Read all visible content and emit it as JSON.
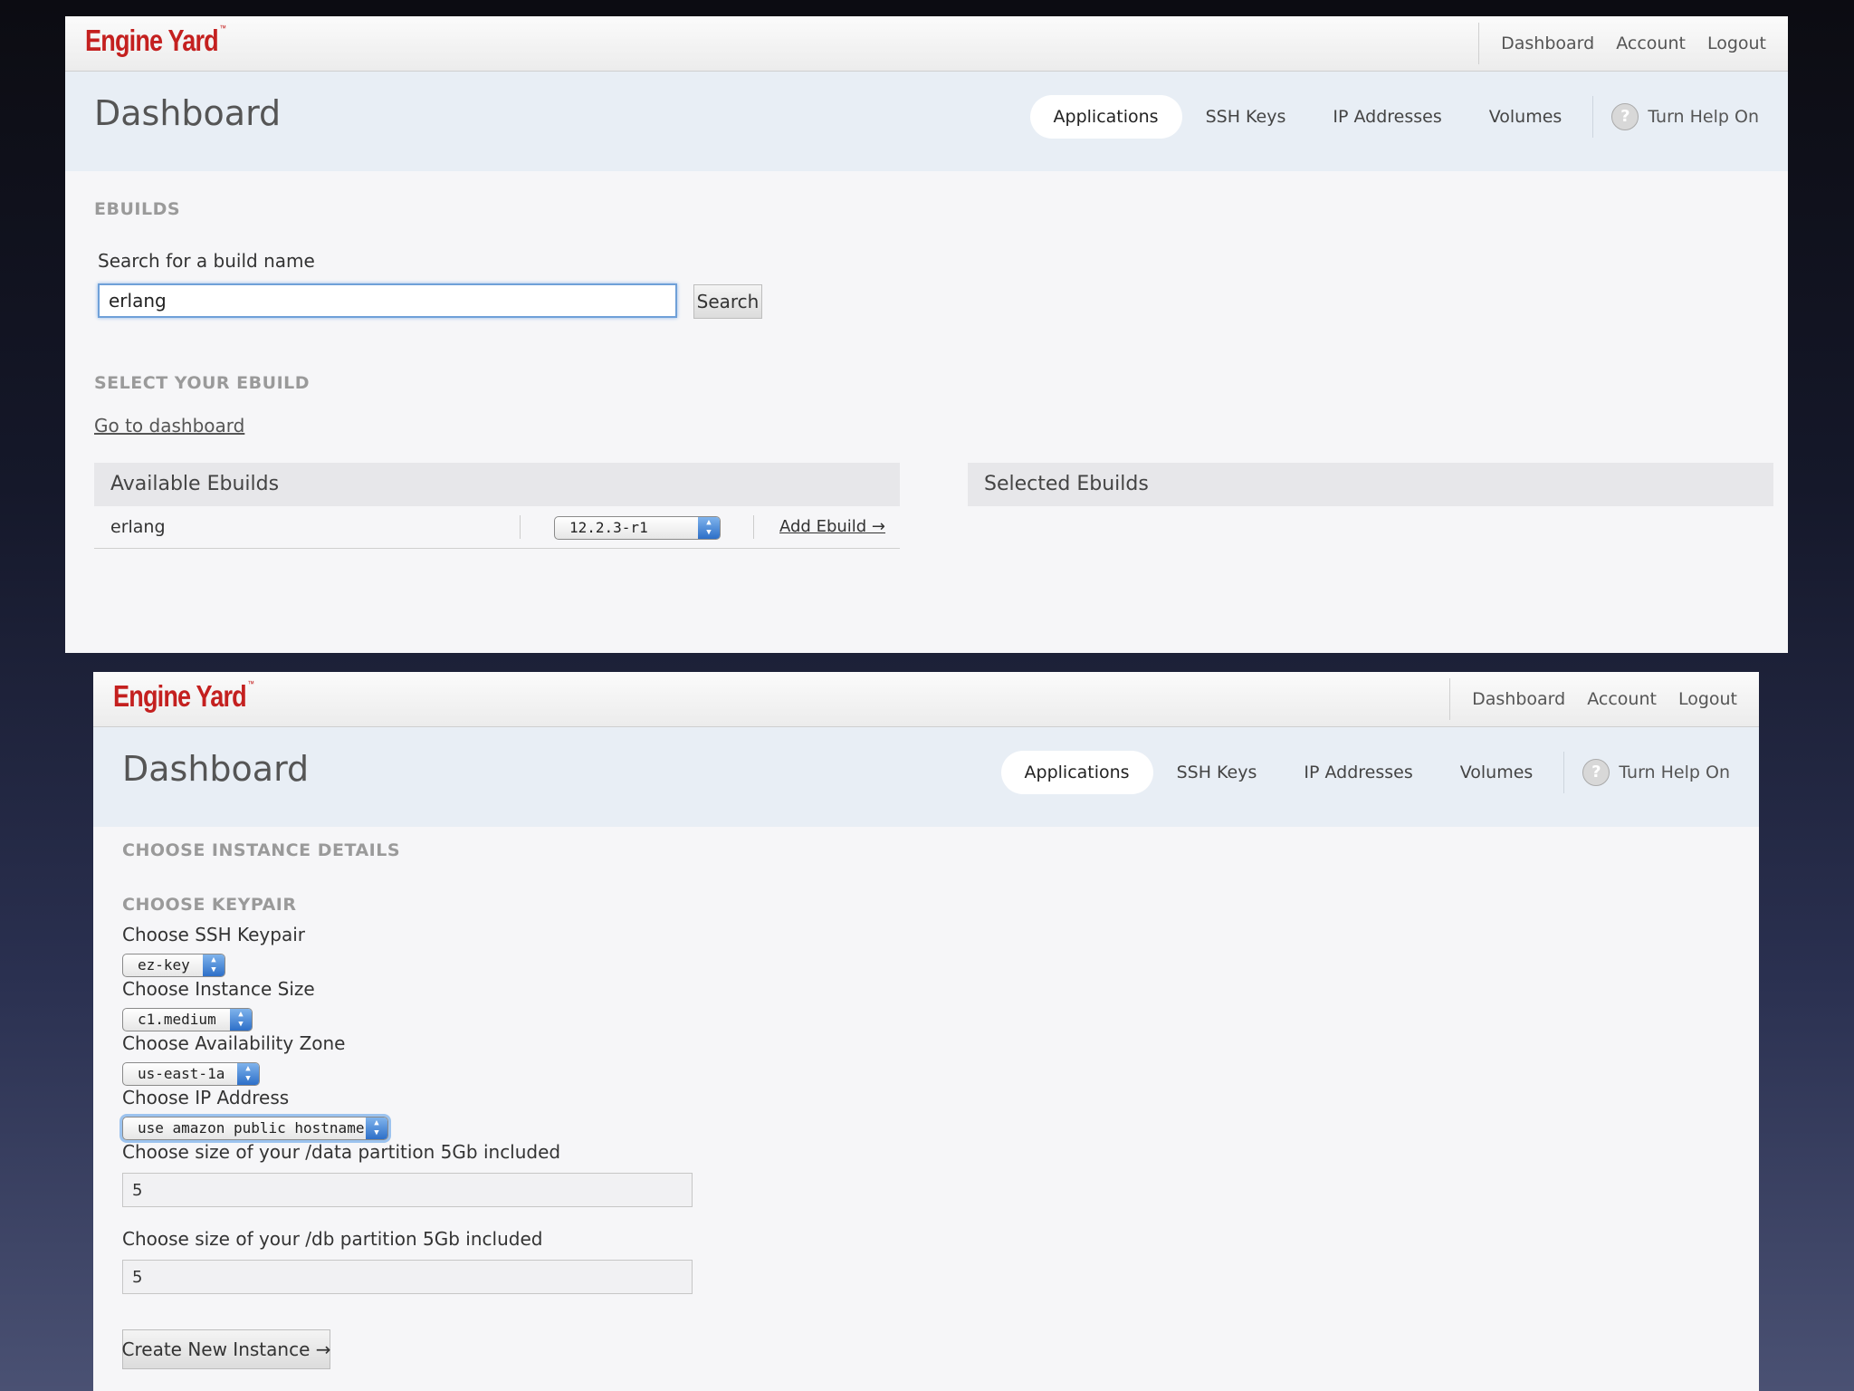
{
  "brand": {
    "name": "Engine Yard",
    "tm": "™",
    "color": "#c4201f"
  },
  "top_nav": {
    "dashboard": "Dashboard",
    "account": "Account",
    "logout": "Logout"
  },
  "header": {
    "title": "Dashboard",
    "tabs": {
      "applications": "Applications",
      "ssh_keys": "SSH Keys",
      "ip_addresses": "IP Addresses",
      "volumes": "Volumes"
    },
    "help": "Turn Help On"
  },
  "panel1": {
    "section": "EBUILDS",
    "search_label": "Search for a build name",
    "search_value": "erlang",
    "search_button": "Search",
    "select_section": "SELECT YOUR EBUILD",
    "go_dashboard": "Go to dashboard",
    "available_title": "Available Ebuilds",
    "selected_title": "Selected Ebuilds",
    "rows": [
      {
        "name": "erlang",
        "version": "12.2.3-r1",
        "action": "Add Ebuild →"
      }
    ]
  },
  "panel2": {
    "section": "CHOOSE INSTANCE DETAILS",
    "keypair_section": "CHOOSE KEYPAIR",
    "keypair_label": "Choose SSH Keypair",
    "keypair_value": "ez-key",
    "size_label": "Choose Instance Size",
    "size_value": "c1.medium",
    "zone_label": "Choose Availability Zone",
    "zone_value": "us-east-1a",
    "ip_label": "Choose IP Address",
    "ip_value": "use amazon public hostname",
    "data_label": "Choose size of your /data partition 5Gb included",
    "data_value": "5",
    "db_label": "Choose size of your /db partition 5Gb included",
    "db_value": "5",
    "create_button": "Create New Instance →"
  }
}
